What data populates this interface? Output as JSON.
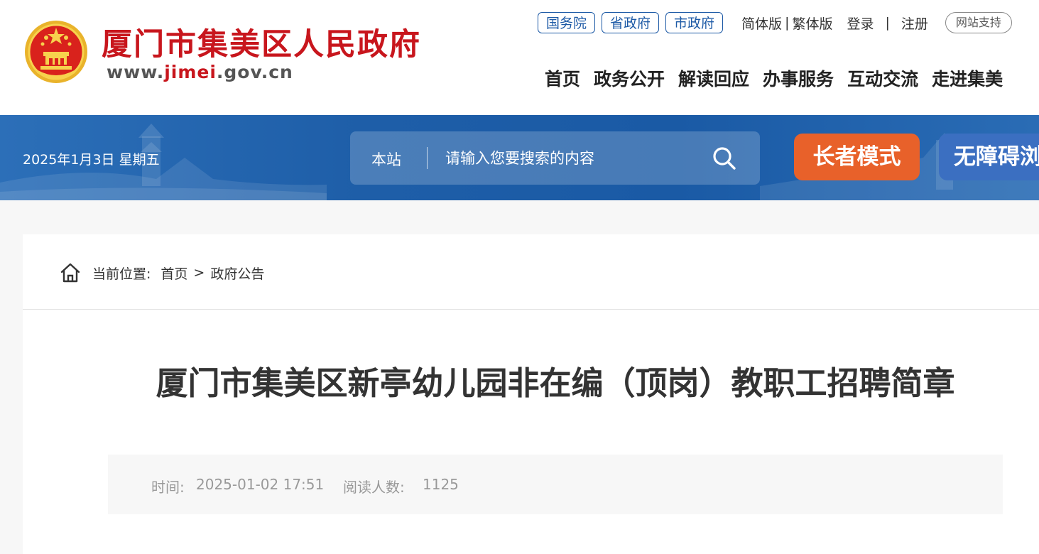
{
  "header": {
    "site_title": "厦门市集美区人民政府",
    "site_url_prefix": "www.",
    "site_url_domain": "jimei",
    "site_url_suffix": ".gov.cn",
    "gov_links": [
      "国务院",
      "省政府",
      "市政府"
    ],
    "lang_simplified": "简体版",
    "lang_separator": "|",
    "lang_traditional": "繁体版",
    "login": "登录",
    "account_separator": "|",
    "register": "注册",
    "support_label": "网站支持",
    "nav": [
      "首页",
      "政务公开",
      "解读回应",
      "办事服务",
      "互动交流",
      "走进集美"
    ]
  },
  "banner": {
    "date": "2025年1月3日 星期五",
    "search_scope": "本站",
    "search_placeholder": "请输入您要搜索的内容",
    "elder_mode": "长者模式",
    "accessibility_mode": "无障碍浏览"
  },
  "breadcrumb": {
    "label": "当前位置:",
    "home": "首页",
    "arrow": ">",
    "current": "政府公告"
  },
  "article": {
    "title": "厦门市集美区新亭幼儿园非在编（顶岗）教职工招聘简章",
    "time_label": "时间:",
    "time_value": "2025-01-02 17:51",
    "reads_label": "阅读人数:",
    "reads_value": "1125"
  },
  "colors": {
    "brand_red": "#c8161d",
    "brand_blue": "#1d5aa6",
    "elder_orange": "#e8612a",
    "access_blue": "#3b6fc1"
  },
  "icons": [
    "national-emblem",
    "search-icon",
    "home-icon"
  ]
}
